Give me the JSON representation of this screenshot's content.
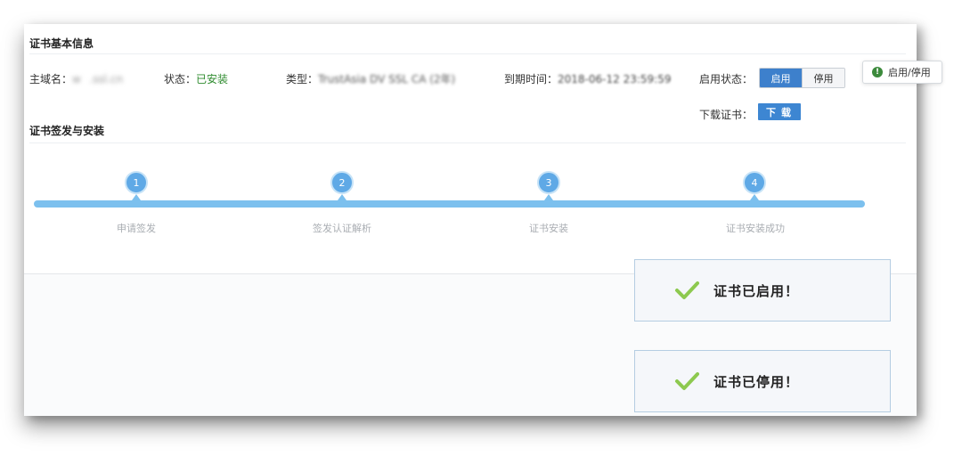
{
  "basic_info": {
    "title": "证书基本信息",
    "host_label": "主域名：",
    "host_value": "w    .ssl.cn",
    "status_label": "状态：",
    "status_value": "已安装",
    "type_label": "类型：",
    "type_value": "TrustAsia DV SSL CA (2年)",
    "expiry_label": "到期时间：",
    "expiry_value": "2018-06-12 23:59:59",
    "enable_label": "启用状态：",
    "enable_on": "启用",
    "enable_off": "停用",
    "download_label": "下载证书：",
    "download_button": "下载",
    "tooltip_text": "启用/停用",
    "tooltip_icon": "info-icon"
  },
  "issuance": {
    "title": "证书签发与安装",
    "steps": [
      {
        "num": "1",
        "label": "申请签发"
      },
      {
        "num": "2",
        "label": "签发认证解析"
      },
      {
        "num": "3",
        "label": "证书安装"
      },
      {
        "num": "4",
        "label": "证书安装成功"
      }
    ]
  },
  "toasts": {
    "enabled_msg": "证书已启用！",
    "disabled_msg": "证书已停用！",
    "icon": "check-icon"
  },
  "colors": {
    "primary": "#3d80cc",
    "track": "#7cc0ee",
    "success": "#8dc94f",
    "status_green": "#2e8b2e"
  }
}
